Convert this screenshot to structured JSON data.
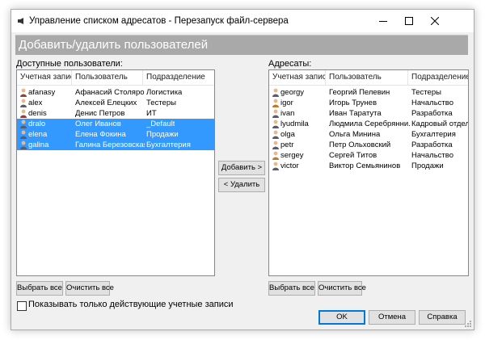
{
  "window": {
    "title": "Управление списком адресатов - Перезапуск файл-сервера",
    "header": "Добавить/удалить пользователей"
  },
  "available": {
    "label": "Доступные пользователи:",
    "columns": [
      "Учетная запись",
      "Пользователь",
      "Подразделение"
    ],
    "rows": [
      {
        "account": "afanasy",
        "user": "Афанасий Столяров",
        "dept": "Логистика",
        "selected": false,
        "icon_color": "#8b4a2b"
      },
      {
        "account": "alex",
        "user": "Алексей Елецких",
        "dept": "Тестеры",
        "selected": false,
        "icon_color": "#5b5b6b"
      },
      {
        "account": "denis",
        "user": "Денис Петров",
        "dept": "ИТ",
        "selected": false,
        "icon_color": "#a83232"
      },
      {
        "account": "dralo",
        "user": "Олег Иванов",
        "dept": "_Default",
        "selected": true,
        "icon_color": "#5b5b6b"
      },
      {
        "account": "elena",
        "user": "Елена Фокина",
        "dept": "Продажи",
        "selected": true,
        "icon_color": "#5b5b6b"
      },
      {
        "account": "galina",
        "user": "Галина Березовская",
        "dept": "Бухгалтерия",
        "selected": true,
        "icon_color": "#5b5b6b"
      }
    ],
    "select_all": "Выбрать все",
    "clear_all": "Очистить все"
  },
  "recipients": {
    "label": "Адресаты:",
    "columns": [
      "Учетная запись",
      "Пользователь",
      "Подразделение"
    ],
    "rows": [
      {
        "account": "georgy",
        "user": "Георгий Пелевин",
        "dept": "Тестеры",
        "selected": false,
        "icon_color": "#5b5b6b"
      },
      {
        "account": "igor",
        "user": "Игорь Трунев",
        "dept": "Начальство",
        "selected": false,
        "icon_color": "#c07a2a"
      },
      {
        "account": "ivan",
        "user": "Иван Таратута",
        "dept": "Разработка",
        "selected": false,
        "icon_color": "#5b5b6b"
      },
      {
        "account": "lyudmila",
        "user": "Людмила Серебрянни...",
        "dept": "Кадровый отдел",
        "selected": false,
        "icon_color": "#5b5b6b"
      },
      {
        "account": "olga",
        "user": "Ольга Минина",
        "dept": "Бухгалтерия",
        "selected": false,
        "icon_color": "#5b5b6b"
      },
      {
        "account": "petr",
        "user": "Петр Ольховский",
        "dept": "Разработка",
        "selected": false,
        "icon_color": "#5b5b6b"
      },
      {
        "account": "sergey",
        "user": "Сергей Титов",
        "dept": "Начальство",
        "selected": false,
        "icon_color": "#c07a2a"
      },
      {
        "account": "victor",
        "user": "Виктор Семьянинов",
        "dept": "Продажи",
        "selected": false,
        "icon_color": "#5b5b6b"
      }
    ],
    "select_all": "Выбрать все",
    "clear_all": "Очистить все"
  },
  "actions": {
    "add": "Добавить >",
    "remove": "< Удалить"
  },
  "options": {
    "active_only_label": "Показывать только действующие учетные записи",
    "active_only_checked": false
  },
  "footer": {
    "ok": "OK",
    "cancel": "Отмена",
    "help": "Справка"
  },
  "colors": {
    "selection": "#3399ff",
    "header_band": "#a9a9a9",
    "default_button_border": "#0078d7"
  }
}
